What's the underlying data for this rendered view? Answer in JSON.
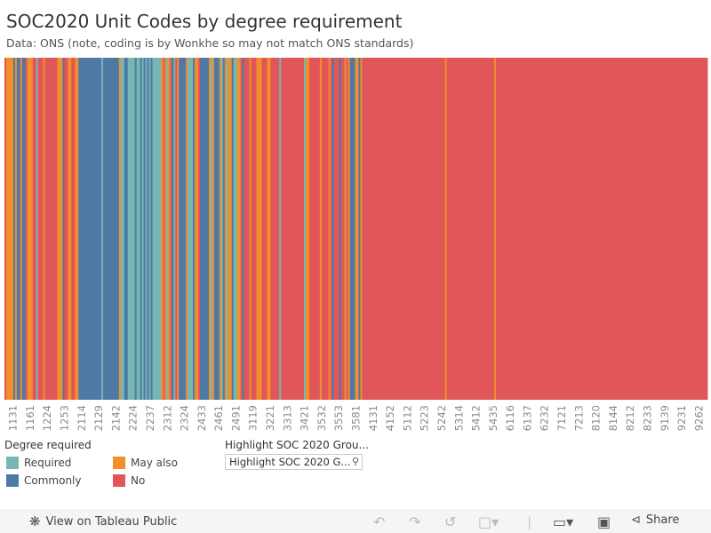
{
  "title": "SOC2020 Unit Codes by degree requirement",
  "subtitle": "Data: ONS (note, coding is by Wonkhe so may not match ONS standards)",
  "chart_data": {
    "type": "bar",
    "orientation": "vertical-stripes",
    "colors": {
      "Required": "#76b7b2",
      "Commonly": "#4e79a7",
      "May also": "#f28e2b",
      "No": "#e15759"
    },
    "tick_labels": [
      "1131",
      "1161",
      "1224",
      "1253",
      "2114",
      "2129",
      "2142",
      "2224",
      "2237",
      "2312",
      "2324",
      "2433",
      "2461",
      "2491",
      "3119",
      "3221",
      "3313",
      "3421",
      "3532",
      "3553",
      "3581",
      "4131",
      "4152",
      "5112",
      "5223",
      "5242",
      "5314",
      "5412",
      "5435",
      "6116",
      "6137",
      "6232",
      "7121",
      "7213",
      "8120",
      "8144",
      "8212",
      "8233",
      "9139",
      "9231",
      "9262"
    ],
    "runs": [
      [
        "No",
        1
      ],
      [
        "May also",
        4
      ],
      [
        "Commonly",
        1
      ],
      [
        "May also",
        1
      ],
      [
        "Commonly",
        2
      ],
      [
        "May also",
        1
      ],
      [
        "Commonly",
        2
      ],
      [
        "No",
        1
      ],
      [
        "May also",
        3
      ],
      [
        "No",
        2
      ],
      [
        "Required",
        1
      ],
      [
        "No",
        3
      ],
      [
        "May also",
        1
      ],
      [
        "No",
        7
      ],
      [
        "May also",
        3
      ],
      [
        "Commonly",
        1
      ],
      [
        "No",
        2
      ],
      [
        "May also",
        2
      ],
      [
        "No",
        2
      ],
      [
        "May also",
        2
      ],
      [
        "Commonly",
        13
      ],
      [
        "Required",
        1
      ],
      [
        "Commonly",
        9
      ],
      [
        "May also",
        1
      ],
      [
        "Required",
        2
      ],
      [
        "Commonly",
        2
      ],
      [
        "Required",
        4
      ],
      [
        "Commonly",
        1
      ],
      [
        "Required",
        2
      ],
      [
        "Commonly",
        1
      ],
      [
        "Required",
        1
      ],
      [
        "Commonly",
        1
      ],
      [
        "Required",
        1
      ],
      [
        "Commonly",
        1
      ],
      [
        "Required",
        1
      ],
      [
        "Commonly",
        1
      ],
      [
        "Required",
        5
      ],
      [
        "May also",
        1
      ],
      [
        "No",
        1
      ],
      [
        "May also",
        1
      ],
      [
        "Required",
        1
      ],
      [
        "May also",
        1
      ],
      [
        "No",
        1
      ],
      [
        "Commonly",
        1
      ],
      [
        "Required",
        1
      ],
      [
        "No",
        1
      ],
      [
        "May also",
        1
      ],
      [
        "Commonly",
        4
      ],
      [
        "May also",
        1
      ],
      [
        "Required",
        3
      ],
      [
        "Commonly",
        1
      ],
      [
        "May also",
        2
      ],
      [
        "No",
        1
      ],
      [
        "Commonly",
        5
      ],
      [
        "May also",
        1
      ],
      [
        "Required",
        1
      ],
      [
        "May also",
        1
      ],
      [
        "Commonly",
        3
      ],
      [
        "May also",
        1
      ],
      [
        "Required",
        1
      ],
      [
        "Commonly",
        1
      ],
      [
        "May also",
        1
      ],
      [
        "Required",
        1
      ],
      [
        "May also",
        2
      ],
      [
        "Commonly",
        1
      ],
      [
        "Required",
        2
      ],
      [
        "May also",
        2
      ],
      [
        "No",
        1
      ],
      [
        "Commonly",
        1
      ],
      [
        "No",
        3
      ],
      [
        "May also",
        1
      ],
      [
        "No",
        3
      ],
      [
        "May also",
        3
      ],
      [
        "No",
        3
      ],
      [
        "May also",
        2
      ],
      [
        "No",
        5
      ],
      [
        "Required",
        1
      ],
      [
        "No",
        13
      ],
      [
        "Required",
        1
      ],
      [
        "May also",
        2
      ],
      [
        "No",
        6
      ],
      [
        "May also",
        1
      ],
      [
        "No",
        4
      ],
      [
        "May also",
        1
      ],
      [
        "No",
        1
      ],
      [
        "Commonly",
        1
      ],
      [
        "No",
        3
      ],
      [
        "Commonly",
        1
      ],
      [
        "No",
        2
      ],
      [
        "May also",
        1
      ],
      [
        "No",
        1
      ],
      [
        "May also",
        1
      ],
      [
        "Commonly",
        3
      ],
      [
        "May also",
        2
      ],
      [
        "Commonly",
        1
      ],
      [
        "May also",
        1
      ],
      [
        "No",
        47
      ],
      [
        "May also",
        1
      ],
      [
        "No",
        27
      ],
      [
        "May also",
        1
      ],
      [
        "No",
        120
      ]
    ]
  },
  "legend": {
    "title": "Degree required",
    "items": [
      {
        "label": "Required",
        "color": "#76b7b2"
      },
      {
        "label": "Commonly",
        "color": "#4e79a7"
      },
      {
        "label": "May also",
        "color": "#f28e2b"
      },
      {
        "label": "No",
        "color": "#e15759"
      }
    ]
  },
  "highlight": {
    "title": "Highlight SOC 2020  Grou...",
    "placeholder": "Highlight SOC 2020  G...",
    "icon": "search-icon"
  },
  "toolbar": {
    "view_label": "View on Tableau Public",
    "share_label": "Share"
  }
}
